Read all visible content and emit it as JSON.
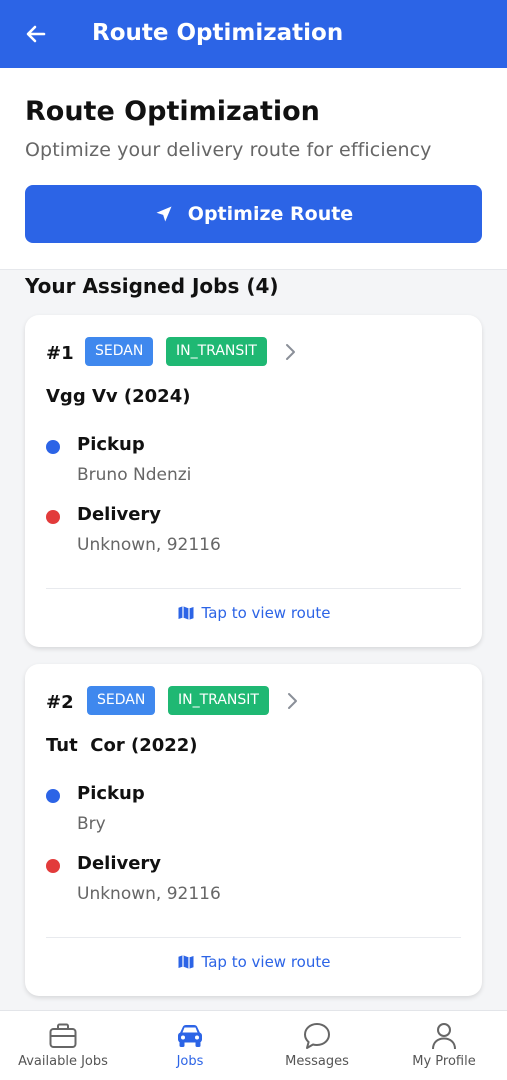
{
  "app_bar": {
    "title": "Route Optimization",
    "back_icon": "arrow-left-icon"
  },
  "header": {
    "title": "Route Optimization",
    "subtitle": "Optimize your delivery route for efficiency",
    "optimize_button": {
      "label": "Optimize Route",
      "icon": "navigation-arrow-icon"
    }
  },
  "jobs_section": {
    "title": "Your Assigned Jobs (4)"
  },
  "jobs": [
    {
      "number": "#1",
      "type_badge": "SEDAN",
      "status_badge": "IN_TRANSIT",
      "vehicle": "Vgg Vv (2024)",
      "pickup_label": "Pickup",
      "pickup_value": "Bruno Ndenzi",
      "delivery_label": "Delivery",
      "delivery_value": "Unknown, 92116",
      "route_link": "Tap to view route"
    },
    {
      "number": "#2",
      "type_badge": "SEDAN",
      "status_badge": "IN_TRANSIT",
      "vehicle": "Tut  Cor (2022)",
      "pickup_label": "Pickup",
      "pickup_value": "Bry",
      "delivery_label": "Delivery",
      "delivery_value": "Unknown, 92116",
      "route_link": "Tap to view route"
    }
  ],
  "bottom_nav": [
    {
      "label": "Available Jobs",
      "icon": "briefcase-icon",
      "active": false
    },
    {
      "label": "Jobs",
      "icon": "car-icon",
      "active": true
    },
    {
      "label": "Messages",
      "icon": "chat-bubble-icon",
      "active": false
    },
    {
      "label": "My Profile",
      "icon": "person-icon",
      "active": false
    }
  ],
  "colors": {
    "primary": "#2c64e6",
    "type_badge": "#3f88ee",
    "status_badge": "#1fb873",
    "pickup_dot": "#2c64e6",
    "delivery_dot": "#e23b3b"
  }
}
